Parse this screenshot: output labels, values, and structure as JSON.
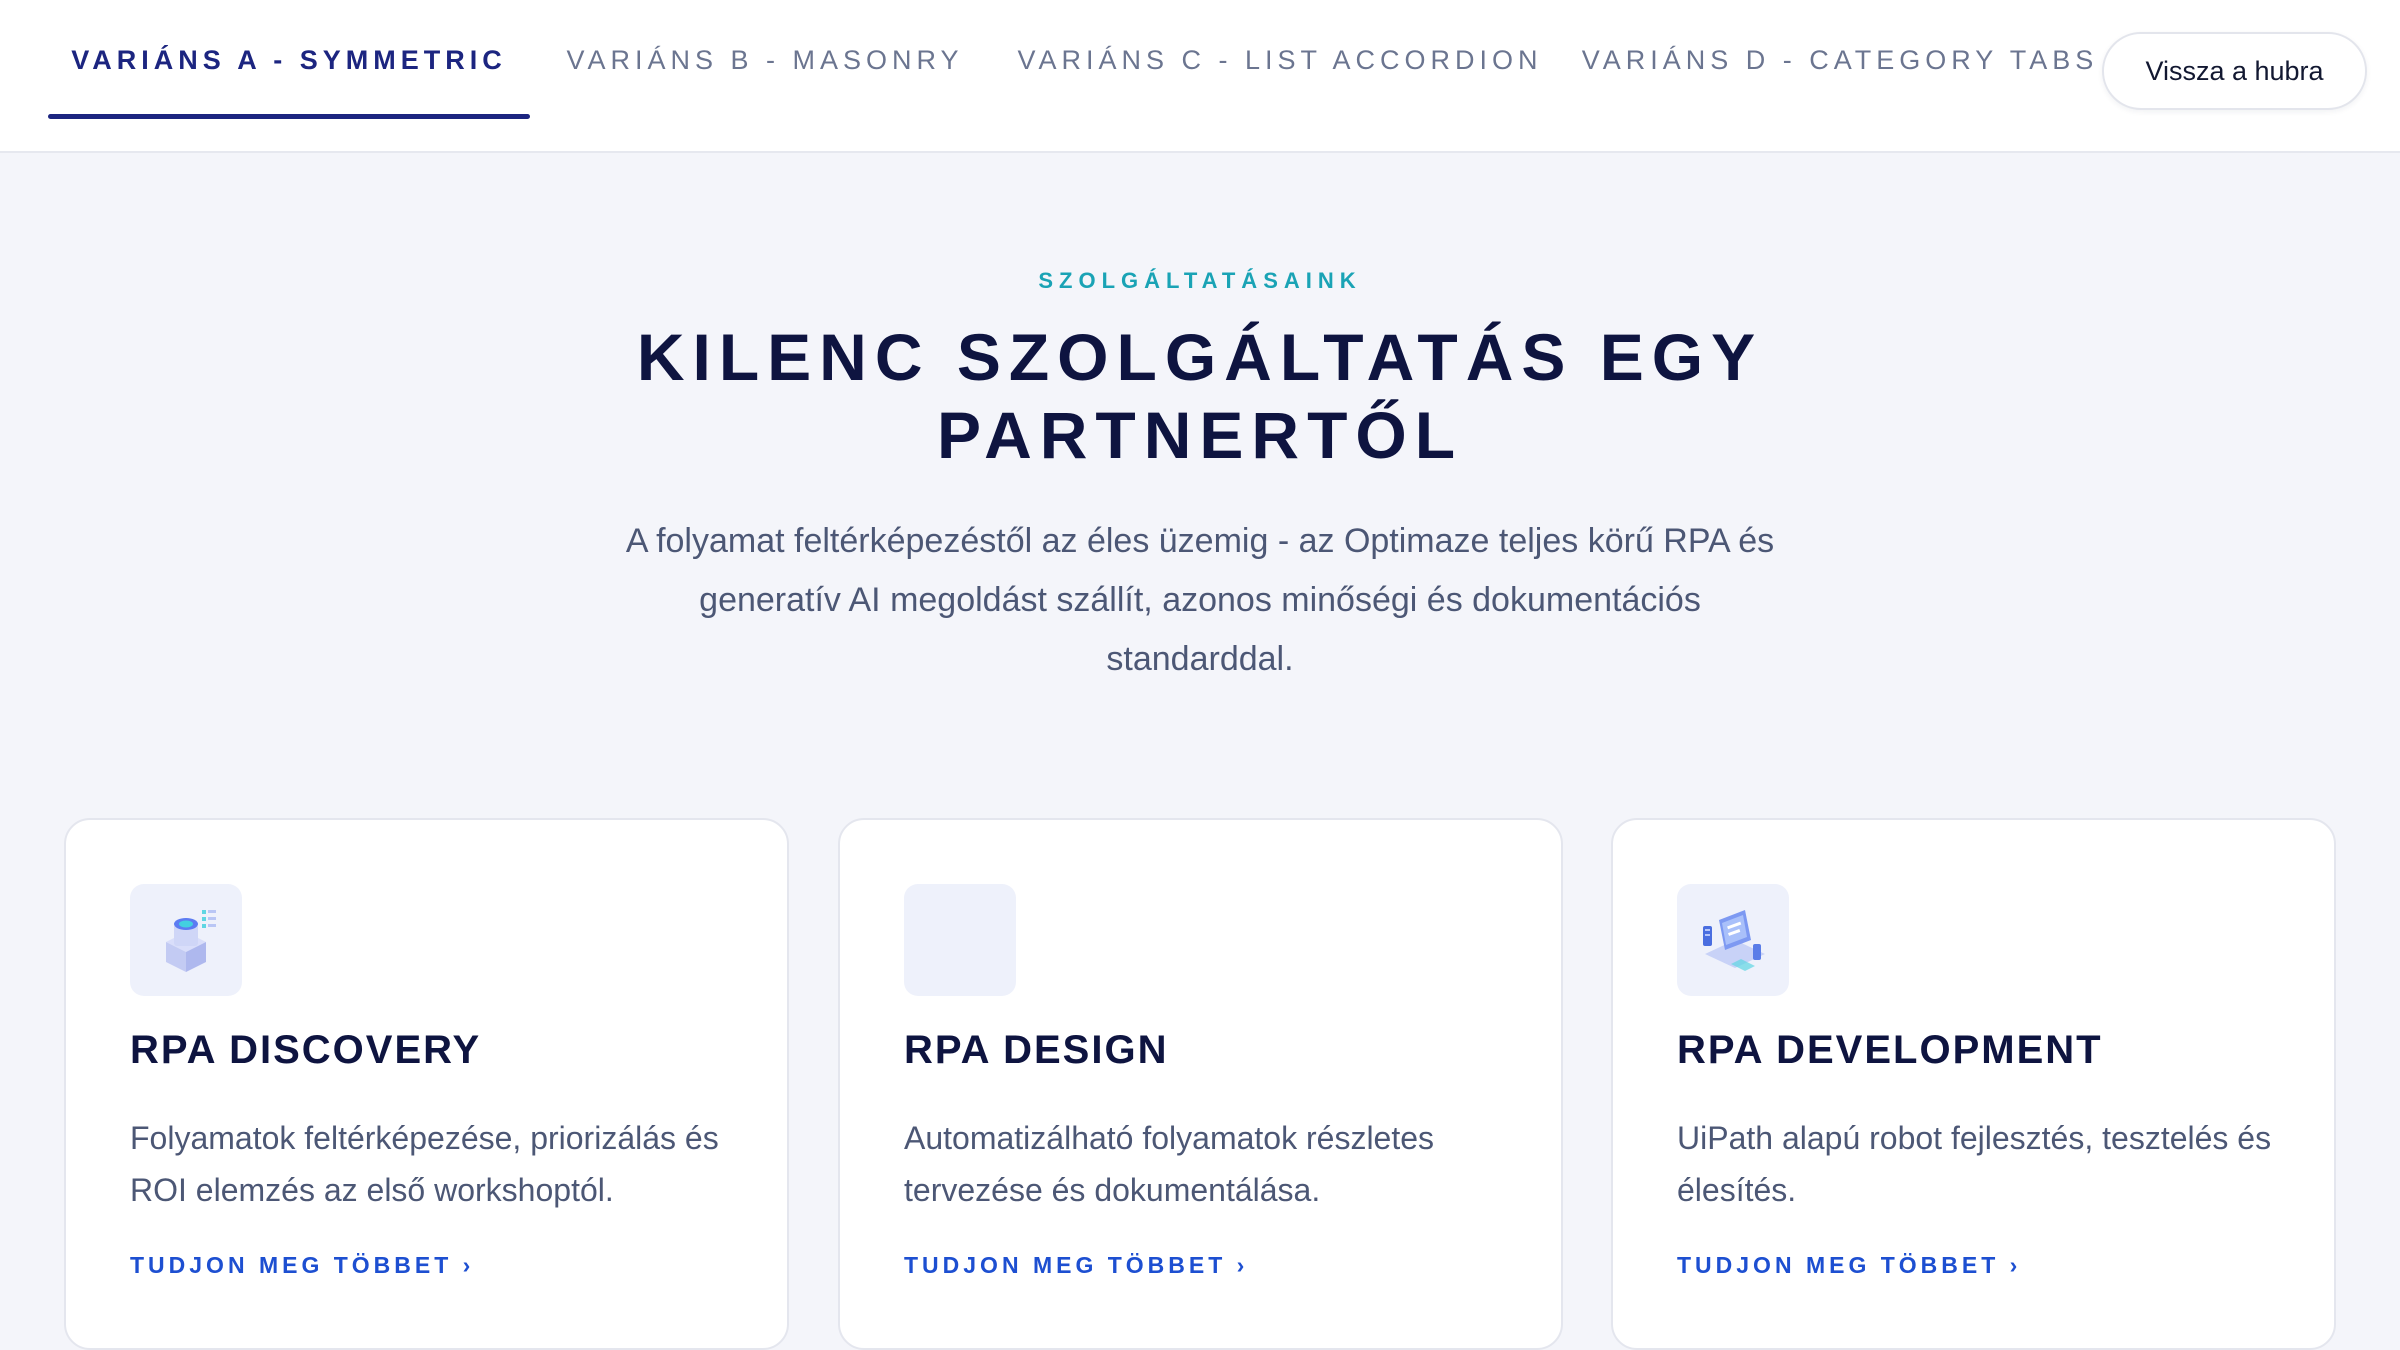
{
  "nav": {
    "tabs": [
      {
        "label": "VARIÁNS A - SYMMETRIC",
        "active": true
      },
      {
        "label": "VARIÁNS B - MASONRY",
        "active": false
      },
      {
        "label": "VARIÁNS C - LIST ACCORDION",
        "active": false
      },
      {
        "label": "VARIÁNS D - CATEGORY TABS",
        "active": false
      }
    ],
    "back_label": "Vissza a hubra"
  },
  "hero": {
    "eyebrow": "SZOLGÁLTATÁSAINK",
    "title": "KILENC SZOLGÁLTATÁS EGY PARTNERTŐL",
    "subtitle": "A folyamat feltérképezéstől az éles üzemig - az Optimaze teljes körű RPA és generatív AI megoldást szállít, azonos minőségi és dokumentációs standarddal."
  },
  "cards": [
    {
      "icon": "server-isometric-icon",
      "title": "RPA DISCOVERY",
      "description": "Folyamatok feltérképezése, priorizálás és ROI elemzés az első workshoptól.",
      "link": "TUDJON MEG TÖBBET ›"
    },
    {
      "icon": "design-placeholder-icon",
      "title": "RPA DESIGN",
      "description": "Automatizálható folyamatok részletes tervezése és dokumentálása.",
      "link": "TUDJON MEG TÖBBET ›"
    },
    {
      "icon": "laptop-devices-icon",
      "title": "RPA DEVELOPMENT",
      "description": "UiPath alapú robot fejlesztés, tesztelés és élesítés.",
      "link": "TUDJON MEG TÖBBET ›"
    }
  ],
  "colors": {
    "accent": "#1c2580",
    "eyebrow": "#1aa3b5",
    "link": "#1d4fd1",
    "background": "#f4f5fa"
  }
}
